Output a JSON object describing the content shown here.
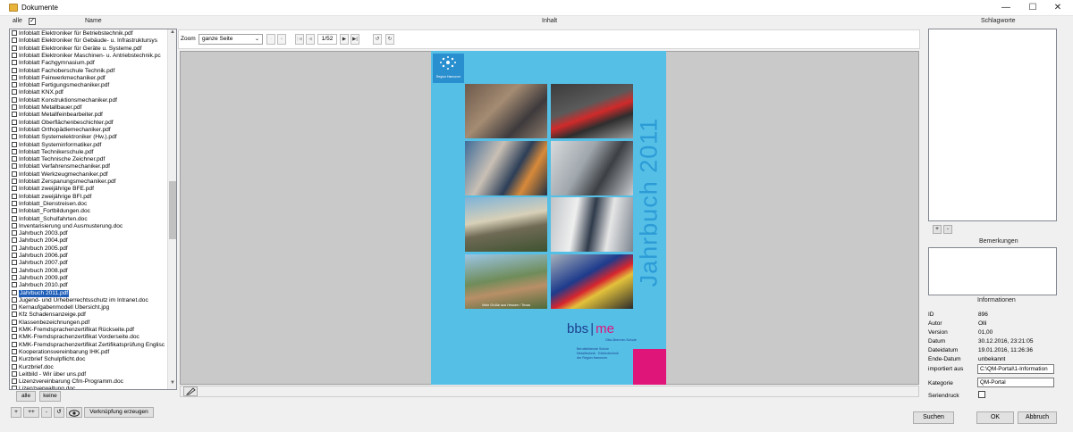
{
  "window": {
    "title": "Dokumente",
    "minimize": "—",
    "maximize": "☐",
    "close": "✕"
  },
  "headers": {
    "alle": "alle",
    "name": "Name",
    "inhalt": "Inhalt",
    "schlagworte": "Schlagworte"
  },
  "files": [
    "Infoblatt Elektroniker für Betriebstechnik.pdf",
    "Infoblatt Elektroniker für Gebäude- u. Infrastruktursys",
    "Infoblatt Elektroniker für Geräte u. Systeme.pdf",
    "Infoblatt Elektroniker Maschinen- u. Antriebstechnik.pc",
    "Infoblatt Fachgymnasium.pdf",
    "Infoblatt Fachoberschule Technik.pdf",
    "Infoblatt Feinwerkmechaniker.pdf",
    "Infoblatt Fertigungsmechaniker.pdf",
    "Infoblatt KNX.pdf",
    "Infoblatt Konstruktionsmechaniker.pdf",
    "Infoblatt Metallbauer.pdf",
    "Infoblatt Metallfeinbearbeiter.pdf",
    "Infoblatt Oberflächenbeschichter.pdf",
    "Infoblatt Orthopädiemechaniker.pdf",
    "Infoblatt Systemelektroniker (Hw.).pdf",
    "Infoblatt Systeminformatiker.pdf",
    "Infoblatt Technikerschule.pdf",
    "Infoblatt Technische Zeichner.pdf",
    "Infoblatt Verfahrensmechaniker.pdf",
    "Infoblatt Werkzeugmechaniker.pdf",
    "Infoblatt Zerspanungsmechaniker.pdf",
    "Infoblatt zweijährige BFE.pdf",
    "Infoblatt zweijährige BFI.pdf",
    "Infoblatt_Dienstreisen.doc",
    "Infoblatt_Fortbildungen.doc",
    "Infoblatt_Schulfahrten.doc",
    "Inventarisierung und Ausmusterung.doc",
    "Jahrbuch 2003.pdf",
    "Jahrbuch 2004.pdf",
    "Jahrbuch 2005.pdf",
    "Jahrbuch 2006.pdf",
    "Jahrbuch 2007.pdf",
    "Jahrbuch 2008.pdf",
    "Jahrbuch 2009.pdf",
    "Jahrbuch 2010.pdf",
    "Jahrbuch 2011.pdf",
    "Jugend- und Urheberrechtsschutz im Intranet.doc",
    "Kernaufgabenmodell Übersicht.jpg",
    "Kfz Schadensanzeige.pdf",
    "Klassenbezeichnungen.pdf",
    "KMK-Fremdsprachenzertifikat Rückseite.pdf",
    "KMK-Fremdsprachenzertifikat Vorderseite.doc",
    "KMK-Fremdsprachenzertifikat Zertifikatsprüfung Englisc",
    "Kooperationsvereinbarung IHK.pdf",
    "Kurzbrief Schulpflicht.doc",
    "Kurzbrief.doc",
    "Leitbild - Wir über uns.pdf",
    "Lizenzvereinbarung Cfm-Programm.doc",
    "Lizenzverwaltung.doc"
  ],
  "selected_file": "Jahrbuch 2011.pdf",
  "list_buttons": {
    "alle": "alle",
    "keine": "keine"
  },
  "bottom_buttons": {
    "plus": "+",
    "plusplus": "++",
    "minus": "-",
    "refresh": "↺",
    "link": "Verknüpfung erzeugen"
  },
  "toolbar": {
    "zoom_label": "Zoom",
    "zoom_value": "ganze Seite",
    "zoom_minus": "-",
    "zoom_plus": "+",
    "page_display": "1/52"
  },
  "cover": {
    "title": "Jahrbuch 2011",
    "logo_text": "Region Hannover",
    "caption": "Viele Grüße aus Hessen / Texas",
    "brand_left": "bbs",
    "brand_right": "me",
    "brand_sub": "Otto-Brenner-Schule",
    "school_lines": [
      "Berufsbildende Schule",
      "Metalltechnik · Elektrotechnik",
      "der Region Hannover"
    ]
  },
  "right": {
    "keywords_add": "+",
    "keywords_remove": "-",
    "bemerkungen": "Bemerkungen",
    "informationen": "Informationen"
  },
  "info": [
    {
      "label": "ID",
      "value": "896"
    },
    {
      "label": "Autor",
      "value": "Olli"
    },
    {
      "label": "Version",
      "value": "01,00"
    },
    {
      "label": "Datum",
      "value": "30.12.2016, 23:21:05"
    },
    {
      "label": "Dateidatum",
      "value": "19.01.2016, 11:26:36"
    },
    {
      "label": "Ende-Datum",
      "value": "unbekannt"
    }
  ],
  "info_fields": {
    "importiert_label": "importiert aus",
    "importiert_value": "C:\\QM-Portal\\1-Information",
    "kategorie_label": "Kategorie",
    "kategorie_value": "QM-Portal",
    "seriendruck_label": "Seriendruck"
  },
  "footer": {
    "suchen": "Suchen",
    "ok": "OK",
    "abbruch": "Abbruch"
  },
  "colors": {
    "selection": "#1f5eb8",
    "cover_blue": "#55bfe6",
    "cover_pink": "#e0157a",
    "brand_blue": "#1d3f8f"
  },
  "icons": [
    "app-folder-icon",
    "pencil-icon",
    "eye-icon",
    "first-page-icon",
    "prev-page-icon",
    "next-page-icon",
    "last-page-icon",
    "rotate-left-icon",
    "rotate-right-icon"
  ]
}
